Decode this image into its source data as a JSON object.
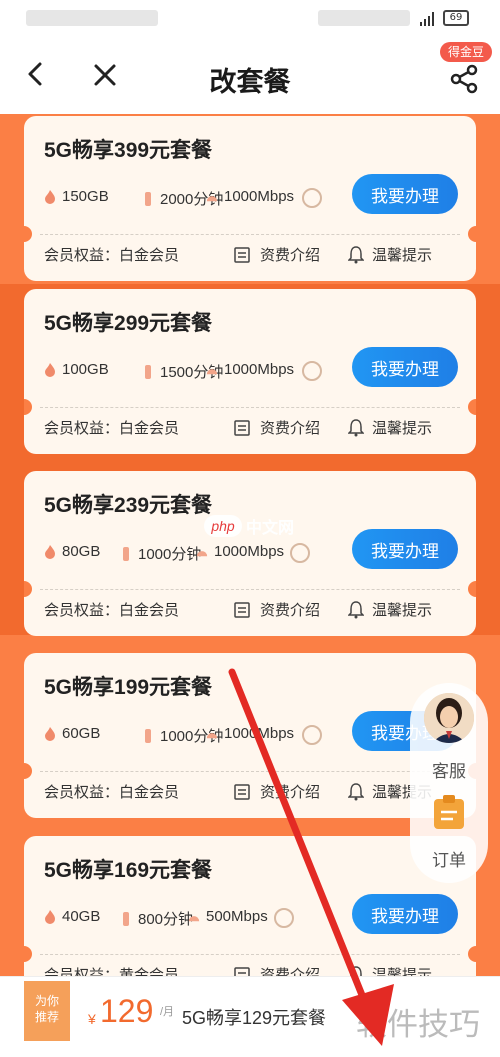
{
  "status_bar": {
    "battery": "69"
  },
  "nav": {
    "title": "改套餐",
    "coin_badge": "得金豆"
  },
  "colors": {
    "accent_orange": "#f26a2e",
    "button_blue": "#2196f3",
    "arrow_red": "#e32a24"
  },
  "plans": [
    {
      "title": "5G畅享399元套餐",
      "data": "150GB",
      "minutes": "2000分钟",
      "speed": "1000Mbps",
      "button": "我要办理",
      "benefit": "会员权益：白金会员",
      "fee_intro": "资费介绍",
      "tips": "温馨提示"
    },
    {
      "title": "5G畅享299元套餐",
      "data": "100GB",
      "minutes": "1500分钟",
      "speed": "1000Mbps",
      "button": "我要办理",
      "benefit": "会员权益：白金会员",
      "fee_intro": "资费介绍",
      "tips": "温馨提示"
    },
    {
      "title": "5G畅享239元套餐",
      "data": "80GB",
      "minutes": "1000分钟",
      "speed": "1000Mbps",
      "button": "我要办理",
      "benefit": "会员权益：白金会员",
      "fee_intro": "资费介绍",
      "tips": "温馨提示"
    },
    {
      "title": "5G畅享199元套餐",
      "data": "60GB",
      "minutes": "1000分钟",
      "speed": "1000Mbps",
      "button": "我要办理",
      "benefit": "会员权益：白金会员",
      "fee_intro": "资费介绍",
      "tips": "温馨提示"
    },
    {
      "title": "5G畅享169元套餐",
      "data": "40GB",
      "minutes": "800分钟",
      "speed": "500Mbps",
      "button": "我要办理",
      "benefit": "会员权益：黄金会员",
      "fee_intro": "资费介绍",
      "tips": "温馨提示"
    }
  ],
  "float_panel": {
    "service": "客服",
    "order": "订单"
  },
  "bottom_bar": {
    "tag_line1": "为你",
    "tag_line2": "推荐",
    "currency": "¥",
    "price": "129",
    "unit": "/月",
    "package": "5G畅享129元套餐"
  },
  "watermarks": {
    "corner": "软件技巧",
    "php_logo": "php",
    "php_text": "中文网"
  }
}
